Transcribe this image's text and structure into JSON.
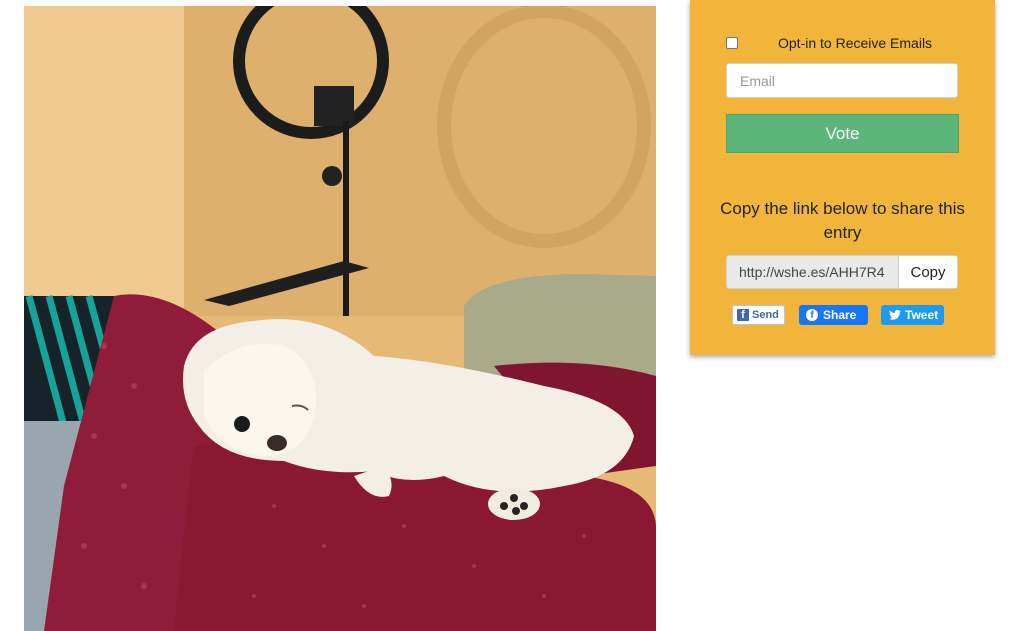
{
  "photo": {
    "subject": "white fluffy dog lying on a red pillow"
  },
  "form": {
    "optin_label": "Opt-in to Receive Emails",
    "optin_checked": false,
    "email_placeholder": "Email",
    "vote_label": "Vote"
  },
  "share": {
    "heading": "Copy the link below to share this entry",
    "link_value": "http://wshe.es/AHH7R4",
    "copy_label": "Copy",
    "send_label": "Send",
    "fb_share_label": "Share",
    "tweet_label": "Tweet"
  },
  "colors": {
    "panel_bg": "#f2b53c",
    "vote_green": "#5cb57a",
    "facebook_blue": "#1877f2",
    "twitter_blue": "#1d9bf0"
  },
  "icons": [
    "facebook-square-icon",
    "facebook-circle-icon",
    "twitter-bird-icon"
  ]
}
